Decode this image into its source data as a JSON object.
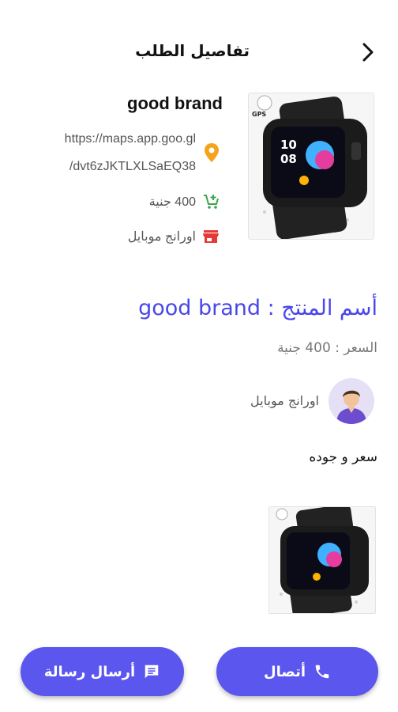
{
  "header": {
    "title": "تفاصيل الطلب"
  },
  "order": {
    "brand": "good brand",
    "url_line1": "https://maps.app.goo.gl",
    "url_line2": "/dvt6zJKTLXLSaEQ38",
    "price": "400 جنية",
    "shop": "اورانج موبايل"
  },
  "product": {
    "title": "أسم المنتج : good brand",
    "price_line": "السعر : 400 جنية",
    "seller_name": "اورانج موبايل",
    "description": "سعر و جوده",
    "watch_badge": "GPS",
    "watch_time_h": "10",
    "watch_time_m": "08"
  },
  "actions": {
    "call_label": "أتصال",
    "message_label": "أرسال رسالة"
  },
  "colors": {
    "accent": "#5b57ee",
    "title_blue": "#4a46e8",
    "location_icon": "#f4a31b",
    "cart_icon": "#3aa44a",
    "shop_icon": "#e53935"
  }
}
